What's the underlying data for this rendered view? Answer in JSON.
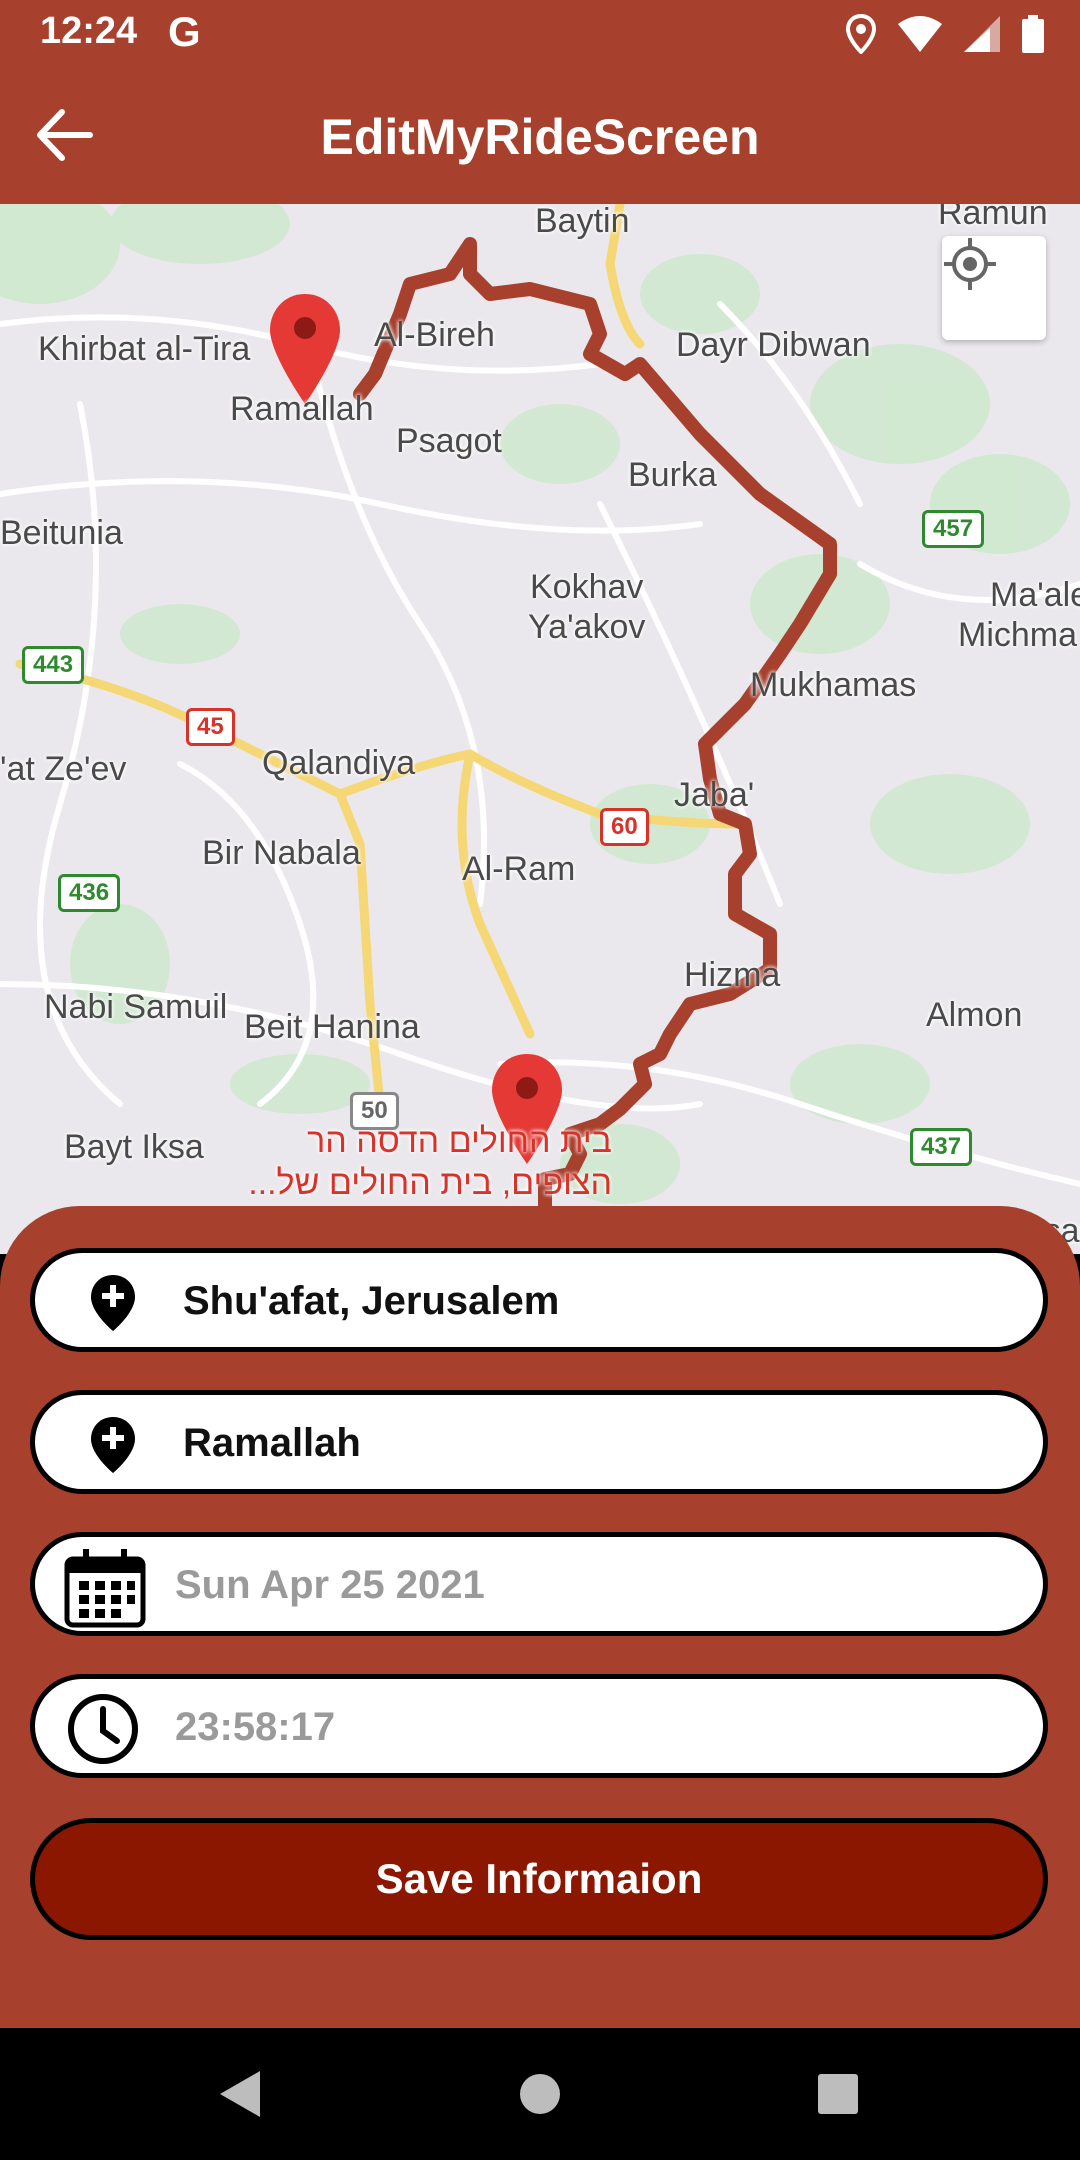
{
  "status": {
    "time": "12:24",
    "g_label": "G"
  },
  "app_bar": {
    "title": "EditMyRideScreen"
  },
  "map": {
    "places": [
      {
        "name": "Baytin",
        "cls": ""
      },
      {
        "name": "Ramun",
        "cls": ""
      },
      {
        "name": "Khirbat al-Tira",
        "cls": ""
      },
      {
        "name": "Al-Bireh",
        "cls": ""
      },
      {
        "name": "Dayr Dibwan",
        "cls": ""
      },
      {
        "name": "Ramallah",
        "cls": ""
      },
      {
        "name": "Psagot",
        "cls": ""
      },
      {
        "name": "Burka",
        "cls": ""
      },
      {
        "name": "Beitunia",
        "cls": ""
      },
      {
        "name": "Kokhav",
        "cls": ""
      },
      {
        "name": "Ya'akov",
        "cls": ""
      },
      {
        "name": "Ma'ale",
        "cls": ""
      },
      {
        "name": "Michma",
        "cls": ""
      },
      {
        "name": "Mukhamas",
        "cls": ""
      },
      {
        "name": "'at Ze'ev",
        "cls": ""
      },
      {
        "name": "Qalandiya",
        "cls": ""
      },
      {
        "name": "Jaba'",
        "cls": ""
      },
      {
        "name": "Bir Nabala",
        "cls": ""
      },
      {
        "name": "Al-Ram",
        "cls": ""
      },
      {
        "name": "Hizma",
        "cls": ""
      },
      {
        "name": "Nabi Samuil",
        "cls": ""
      },
      {
        "name": "Beit Hanina",
        "cls": ""
      },
      {
        "name": "Almon",
        "cls": ""
      },
      {
        "name": "Bayt Iksa",
        "cls": ""
      },
      {
        "name": "בית החולים הדסה הר",
        "cls": "red"
      },
      {
        "name": "הצופים, בית החולים של...",
        "cls": "red"
      },
      {
        "name": "Kasar",
        "cls": ""
      }
    ],
    "shields": [
      {
        "label": "457",
        "cls": "green"
      },
      {
        "label": "443",
        "cls": "green"
      },
      {
        "label": "45",
        "cls": "red"
      },
      {
        "label": "60",
        "cls": "red"
      },
      {
        "label": "436",
        "cls": "green"
      },
      {
        "label": "50",
        "cls": "gray"
      },
      {
        "label": "437",
        "cls": "green"
      }
    ]
  },
  "form": {
    "from_value": "Shu'afat, Jerusalem",
    "to_value": "Ramallah",
    "date_value": "Sun Apr 25 2021",
    "time_value": "23:58:17",
    "save_label": "Save Informaion"
  },
  "colors": {
    "primary": "#a8402e",
    "button": "#8c1700",
    "route": "#a8402e",
    "pin": "#e53935"
  }
}
